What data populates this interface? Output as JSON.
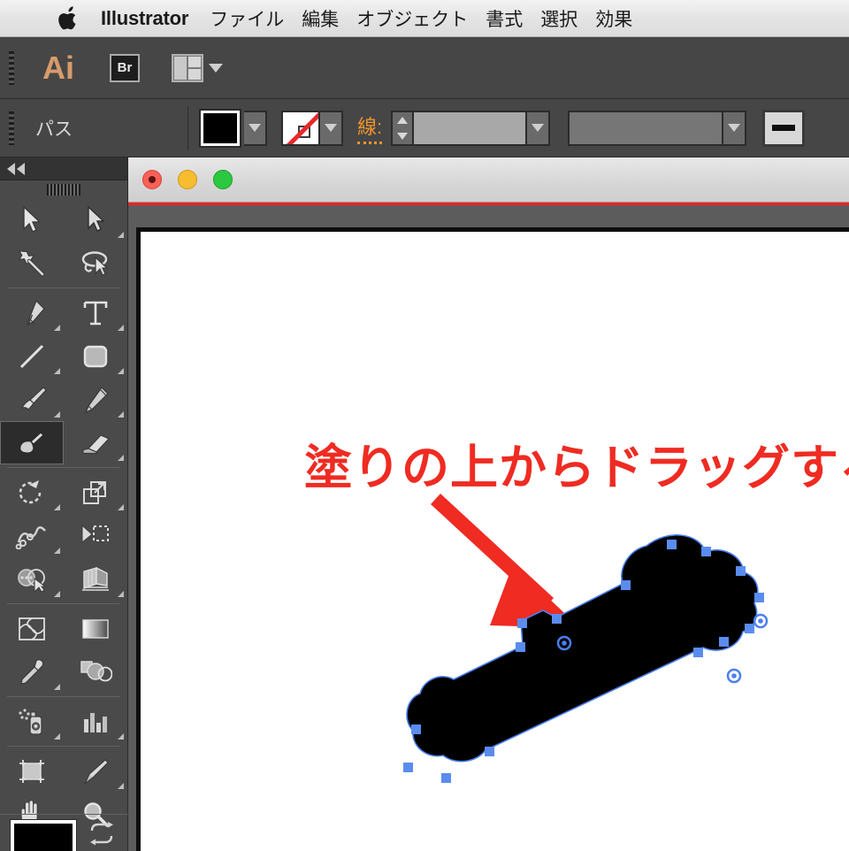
{
  "menubar": {
    "apple_icon": "apple-logo",
    "app_name": "Illustrator",
    "items": [
      {
        "label": "ファイル"
      },
      {
        "label": "編集"
      },
      {
        "label": "オブジェクト"
      },
      {
        "label": "書式"
      },
      {
        "label": "選択"
      },
      {
        "label": "効果"
      }
    ]
  },
  "appbar": {
    "logo_text": "Ai",
    "bridge_label": "Br",
    "arrange_icon": "arrange-documents-icon",
    "arrange_caret": "chevron-down-icon"
  },
  "controlbar": {
    "object_type": "パス",
    "fill_swatch_color": "#000000",
    "fill_dropdown_icon": "chevron-down-icon",
    "stroke_swatch_value": "なし",
    "stroke_dropdown_icon": "chevron-down-icon",
    "stroke_label": "線:",
    "stroke_weight_value": "",
    "stroke_weight_stepper_up": "stepper-up-icon",
    "stroke_weight_stepper_down": "stepper-down-icon",
    "stroke_weight_dropdown_icon": "chevron-down-icon",
    "variable_width_value": "",
    "variable_width_dropdown_icon": "chevron-down-icon",
    "stroke_profile_icon": "uniform-width-profile-icon"
  },
  "toolbox": {
    "collapse_icon": "double-chevron-left-icon",
    "grip_icon": "panel-grip-icon",
    "tools": [
      {
        "name": "selection-tool",
        "icon": "arrow-cursor-icon",
        "corner": false,
        "selected": false
      },
      {
        "name": "direct-selection-tool",
        "icon": "white-arrow-cursor-icon",
        "corner": true,
        "selected": false
      },
      {
        "name": "magic-wand-tool",
        "icon": "magic-wand-icon",
        "corner": false,
        "selected": false
      },
      {
        "name": "lasso-tool",
        "icon": "lasso-icon",
        "corner": false,
        "selected": false
      },
      {
        "name": "pen-tool",
        "icon": "pen-nib-icon",
        "corner": true,
        "selected": false
      },
      {
        "name": "type-tool",
        "icon": "text-t-icon",
        "corner": true,
        "selected": false
      },
      {
        "name": "line-segment-tool",
        "icon": "diagonal-line-icon",
        "corner": true,
        "selected": false
      },
      {
        "name": "rectangle-tool",
        "icon": "rounded-rectangle-icon",
        "corner": true,
        "selected": false
      },
      {
        "name": "paintbrush-tool",
        "icon": "paintbrush-icon",
        "corner": true,
        "selected": false
      },
      {
        "name": "pencil-tool",
        "icon": "pencil-icon",
        "corner": true,
        "selected": false
      },
      {
        "name": "blob-brush-tool",
        "icon": "blob-brush-icon",
        "corner": false,
        "selected": true
      },
      {
        "name": "eraser-tool",
        "icon": "eraser-icon",
        "corner": true,
        "selected": false
      },
      {
        "name": "rotate-tool",
        "icon": "rotate-icon",
        "corner": true,
        "selected": false
      },
      {
        "name": "scale-tool",
        "icon": "scale-icon",
        "corner": true,
        "selected": false
      },
      {
        "name": "width-tool",
        "icon": "width-warp-icon",
        "corner": true,
        "selected": false
      },
      {
        "name": "free-transform-tool",
        "icon": "free-transform-icon",
        "corner": false,
        "selected": false
      },
      {
        "name": "shape-builder-tool",
        "icon": "shape-builder-icon",
        "corner": true,
        "selected": false
      },
      {
        "name": "perspective-grid-tool",
        "icon": "perspective-grid-icon",
        "corner": true,
        "selected": false
      },
      {
        "name": "mesh-tool",
        "icon": "mesh-icon",
        "corner": false,
        "selected": false
      },
      {
        "name": "gradient-tool",
        "icon": "gradient-icon",
        "corner": false,
        "selected": false
      },
      {
        "name": "eyedropper-tool",
        "icon": "eyedropper-icon",
        "corner": true,
        "selected": false
      },
      {
        "name": "blend-tool",
        "icon": "blend-shapes-icon",
        "corner": false,
        "selected": false
      },
      {
        "name": "symbol-sprayer-tool",
        "icon": "symbol-sprayer-icon",
        "corner": true,
        "selected": false
      },
      {
        "name": "column-graph-tool",
        "icon": "bar-graph-icon",
        "corner": true,
        "selected": false
      },
      {
        "name": "artboard-tool",
        "icon": "artboard-icon",
        "corner": false,
        "selected": false
      },
      {
        "name": "slice-tool",
        "icon": "slice-knife-icon",
        "corner": true,
        "selected": false
      },
      {
        "name": "hand-tool",
        "icon": "hand-icon",
        "corner": true,
        "selected": false
      },
      {
        "name": "zoom-tool",
        "icon": "magnifier-icon",
        "corner": false,
        "selected": false
      }
    ],
    "fill_stroke_swatch": "#000000",
    "swap_icon": "swap-fill-stroke-icon"
  },
  "document": {
    "close_button": "close-traffic-light",
    "minimize_button": "minimize-traffic-light",
    "zoom_button": "zoom-traffic-light",
    "annotation_text": "塗りの上からドラッグする",
    "annotation_color": "#ef2b22",
    "arrow_icon": "red-arrow-icon",
    "artwork": {
      "name": "blob-brush-path",
      "fill_color": "#000000",
      "path_outline_color": "#4a7ff0",
      "anchor_color": "#5a8cf0"
    }
  }
}
